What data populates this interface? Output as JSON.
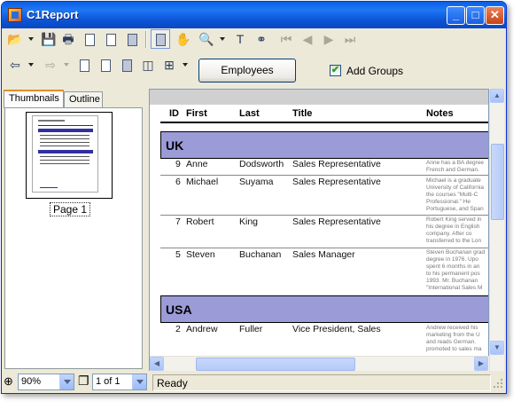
{
  "window": {
    "title": "C1Report",
    "minimize": "_",
    "maximize": "□",
    "close": "✕"
  },
  "toolbar": {
    "open_icon": "folder-open-icon",
    "save_icon": "save-icon",
    "print_icon": "printer-icon",
    "page_setup_icon": "page-setup-icon",
    "text_select_icon": "text-select-icon",
    "find_icon": "binoculars-icon",
    "first_icon": "first-page-icon",
    "prev_icon": "previous-page-icon",
    "next_icon": "next-page-icon",
    "last_icon": "last-page-icon"
  },
  "controls": {
    "employees_button": "Employees",
    "add_groups_label": "Add Groups",
    "add_groups_checked": true
  },
  "tabs": [
    {
      "label": "Thumbnails",
      "active": true
    },
    {
      "label": "Outline",
      "active": false
    }
  ],
  "thumbnail": {
    "page_label": "Page 1"
  },
  "zoom": {
    "value": "90%"
  },
  "pager": {
    "value": "1 of 1"
  },
  "status": {
    "text": "Ready"
  },
  "report": {
    "columns": [
      "ID",
      "First",
      "Last",
      "Title",
      "Notes"
    ],
    "groups": [
      {
        "name": "UK",
        "rows": [
          {
            "id": "9",
            "first": "Anne",
            "last": "Dodsworth",
            "title": "Sales Representative",
            "notes": [
              "Anne has a BA degree",
              "French and German."
            ]
          },
          {
            "id": "6",
            "first": "Michael",
            "last": "Suyama",
            "title": "Sales Representative",
            "notes": [
              "Michael is a graduate",
              "University of California",
              "the courses \"Multi-C",
              "Professional.\"  He",
              "Portuguese, and Span"
            ]
          },
          {
            "id": "7",
            "first": "Robert",
            "last": "King",
            "title": "Sales Representative",
            "notes": [
              "Robert King served in",
              "his degree in English",
              "company.   After co",
              "transferred to the Lon"
            ]
          },
          {
            "id": "5",
            "first": "Steven",
            "last": "Buchanan",
            "title": "Sales Manager",
            "notes": [
              "Steven Buchanan grad",
              "degree in 1976.  Upo",
              "spent 6 months in an",
              "to his permanent pos",
              "1993.  Mr. Buchanan",
              "\"International Sales M"
            ]
          }
        ]
      },
      {
        "name": "USA",
        "rows": [
          {
            "id": "2",
            "first": "Andrew",
            "last": "Fuller",
            "title": "Vice President, Sales",
            "notes": [
              "Andrew received his",
              "marketing from the U",
              "and reads German.",
              "promoted to sales ma"
            ]
          }
        ]
      }
    ]
  }
}
